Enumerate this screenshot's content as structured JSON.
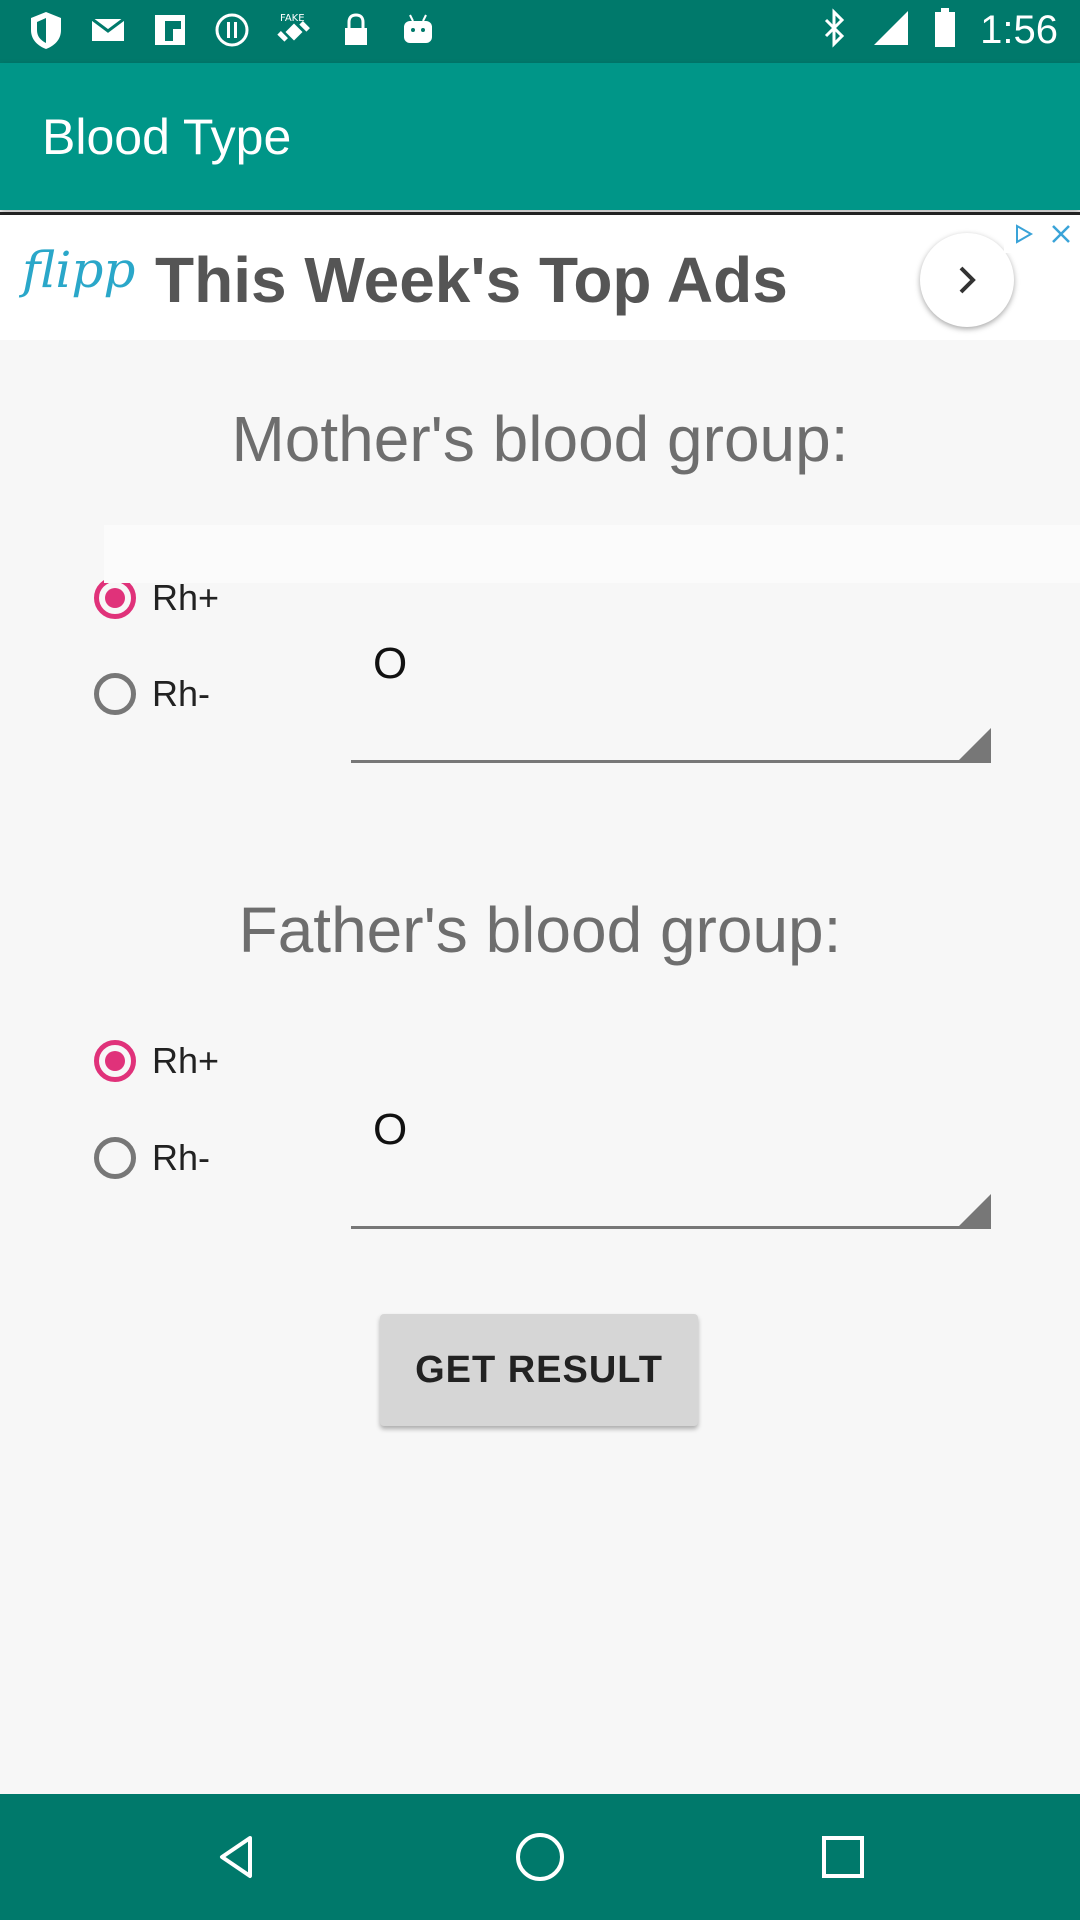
{
  "status_bar": {
    "time": "1:56",
    "left_icons": [
      "shield-icon",
      "mail-icon",
      "flipboard-icon",
      "circle-info-icon",
      "fake-gps-icon",
      "lock-icon",
      "android-icon"
    ],
    "right_icons": [
      "bluetooth-icon",
      "signal-icon",
      "battery-icon"
    ]
  },
  "app_bar": {
    "title": "Blood Type"
  },
  "ad": {
    "logo": "flipp",
    "text": "This Week's Top Ads"
  },
  "mother": {
    "title": "Mother's blood group:",
    "rh_positive": "Rh+",
    "rh_negative": "Rh-",
    "selected": "Rh+",
    "blood_group": "O"
  },
  "father": {
    "title": "Father's blood group:",
    "rh_positive": "Rh+",
    "rh_negative": "Rh-",
    "selected": "Rh+",
    "blood_group": "O"
  },
  "actions": {
    "get_result": "GET RESULT"
  },
  "colors": {
    "status_bar": "#00796b",
    "app_bar": "#009688",
    "accent": "#e0327a",
    "background": "#f7f7f7"
  }
}
